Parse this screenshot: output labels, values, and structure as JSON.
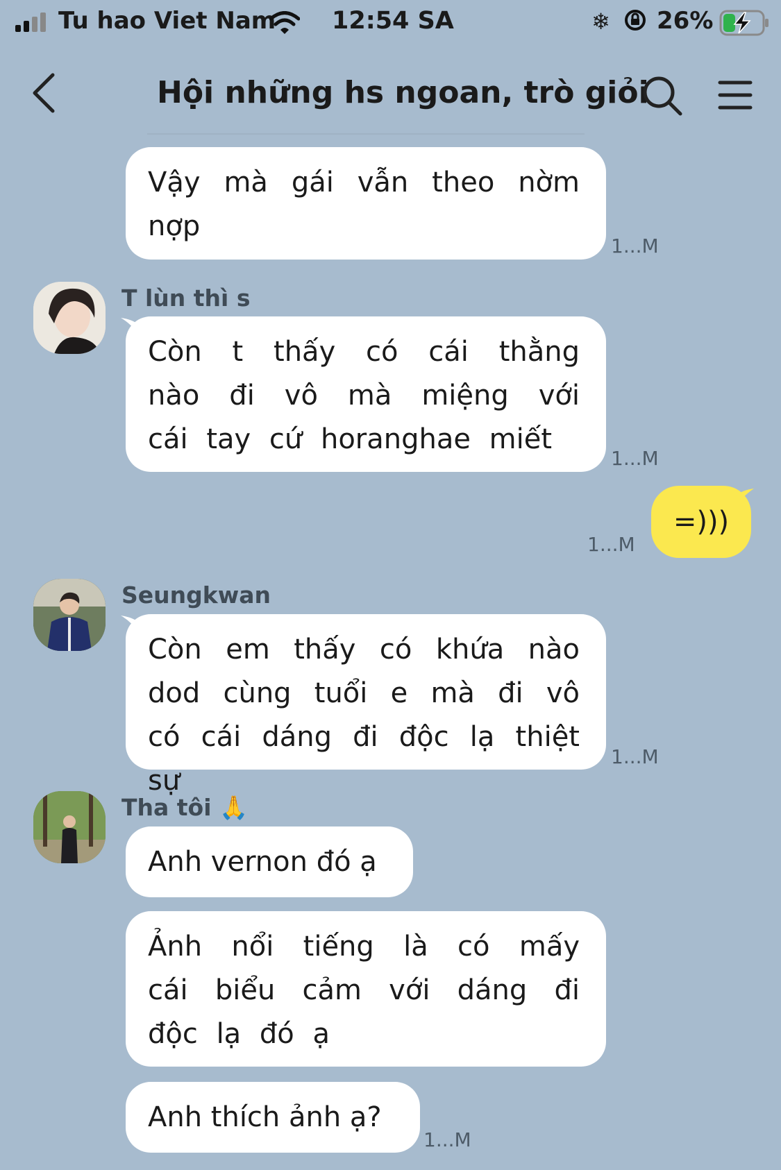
{
  "status_bar": {
    "carrier": "Tu hao Viet Nam",
    "time": "12:54 SA",
    "battery": "26%"
  },
  "header": {
    "title": "Hội những hs ngoan, trò giỏi"
  },
  "messages": [
    {
      "sender": "",
      "text": "Vậy mà gái vẫn theo nờm nợp",
      "time": "1...M"
    },
    {
      "sender": "T lùn thì s",
      "text": "Còn t thấy có cái thằng nào đi vô mà miệng với cái tay cứ horanghae miết",
      "time": "1...M"
    },
    {
      "sender": "me",
      "text": "=)))",
      "time": "1...M"
    },
    {
      "sender": "Seungkwan",
      "text": "Còn em thấy có khứa nào dod cùng tuổi e mà đi vô có cái dáng đi độc lạ thiệt sự",
      "time": "1...M"
    },
    {
      "sender": "Tha tôi 🙏",
      "text": "Anh vernon đó ạ",
      "time": ""
    },
    {
      "sender": "",
      "text": "Ảnh nổi tiếng là có mấy cái biểu cảm với dáng đi độc lạ đó ạ",
      "time": ""
    },
    {
      "sender": "",
      "text": "Anh thích ảnh ạ?",
      "time": "1...M"
    }
  ],
  "colors": {
    "background": "#a7bbce",
    "incoming_bubble": "#ffffff",
    "outgoing_bubble": "#fbe84f"
  }
}
